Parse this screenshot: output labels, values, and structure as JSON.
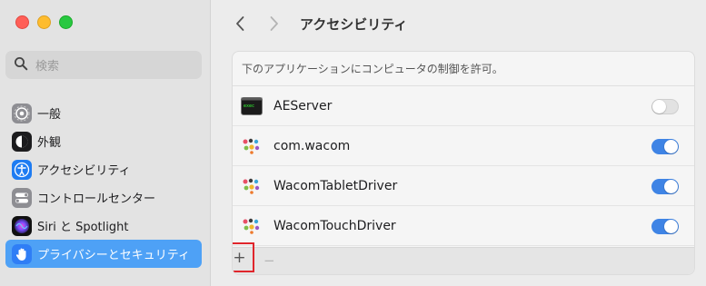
{
  "window": {
    "traffic_lights": [
      "close",
      "minimize",
      "zoom"
    ]
  },
  "sidebar": {
    "search_placeholder": "検索",
    "items": [
      {
        "label": "一般",
        "icon": "gear-icon",
        "active": false
      },
      {
        "label": "外観",
        "icon": "appearance-icon",
        "active": false
      },
      {
        "label": "アクセシビリティ",
        "icon": "accessibility-icon",
        "active": false
      },
      {
        "label": "コントロールセンター",
        "icon": "control-center-icon",
        "active": false
      },
      {
        "label": "Siri と Spotlight",
        "icon": "siri-icon",
        "active": false
      },
      {
        "label": "プライバシーとセキュリティ",
        "icon": "hand-icon",
        "active": true
      }
    ]
  },
  "header": {
    "title": "アクセシビリティ"
  },
  "panel": {
    "description": "下のアプリケーションにコンピュータの制御を許可。",
    "apps": [
      {
        "name": "AEServer",
        "icon": "terminal-app-icon",
        "enabled": false
      },
      {
        "name": "com.wacom",
        "icon": "wacom-icon",
        "enabled": true
      },
      {
        "name": "WacomTabletDriver",
        "icon": "wacom-icon",
        "enabled": true
      },
      {
        "name": "WacomTouchDriver",
        "icon": "wacom-icon",
        "enabled": true
      }
    ],
    "add_label": "+",
    "remove_label": "−"
  },
  "colors": {
    "accent": "#3f84e5",
    "sidebar_selection": "#4ea1f6",
    "highlight_box": "#e0262c"
  }
}
